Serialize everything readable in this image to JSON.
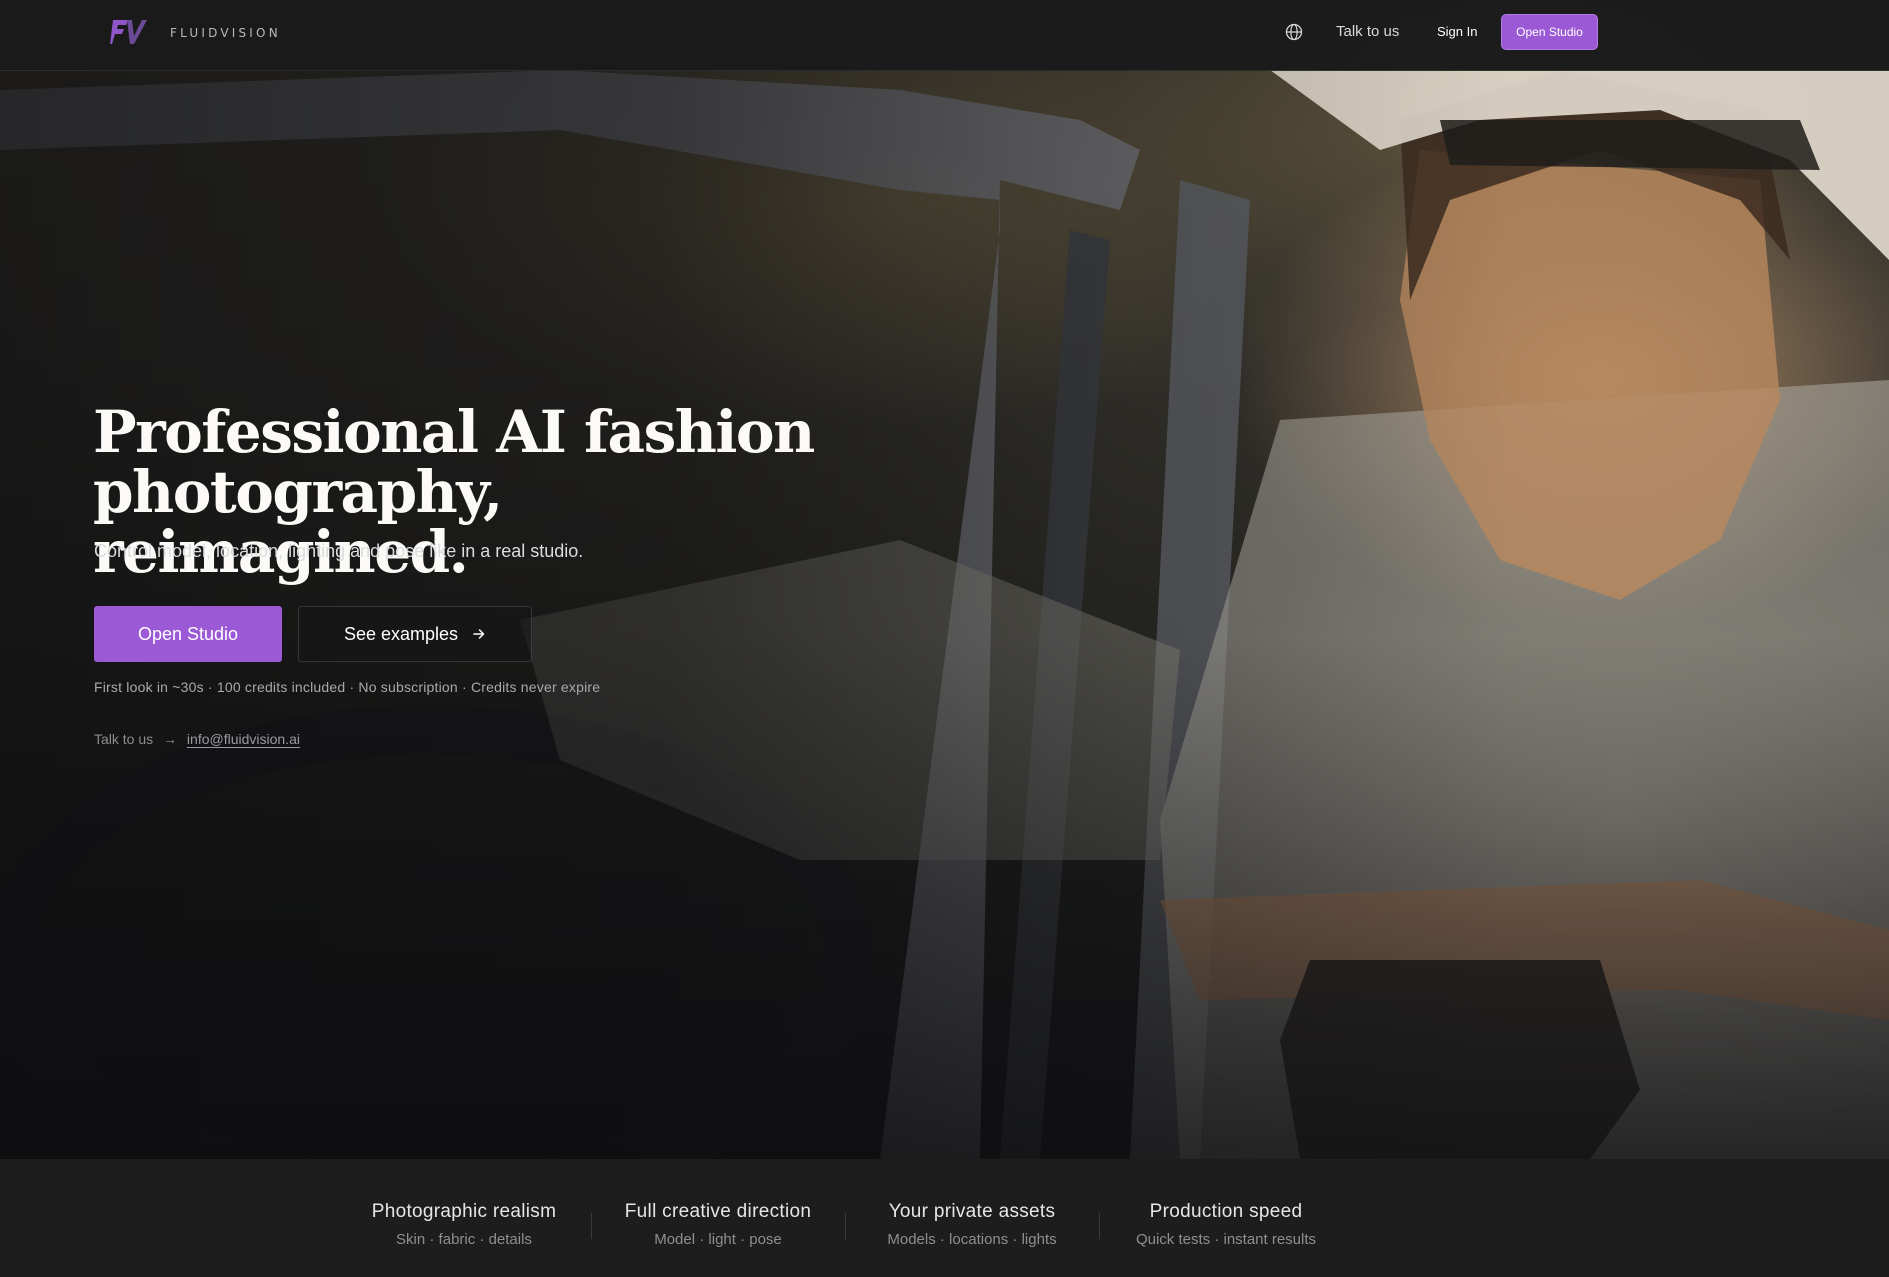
{
  "nav": {
    "brand": "FLUIDVISION",
    "logo_icon": "fv-logo",
    "globe_icon": "globe-icon",
    "talk_label": "Talk to us",
    "signin_label": "Sign In",
    "open_label": "Open Studio"
  },
  "hero": {
    "headline": "Professional AI fashion photography, reimagined.",
    "subhead": "Control model, location, lighting and pose like in a real studio.",
    "primary_cta": "Open Studio",
    "secondary_cta": "See examples",
    "secondary_icon": "arrow-right-icon",
    "fineprint": "First look in ~30s · 100 credits included · No subscription · Credits never expire",
    "contact_label": "Talk to us",
    "contact_arrow": "→",
    "contact_email": "info@fluidvision.ai"
  },
  "features": [
    {
      "title": "Photographic realism",
      "subtitle": "Skin · fabric · details"
    },
    {
      "title": "Full creative direction",
      "subtitle": "Model · light · pose"
    },
    {
      "title": "Your private assets",
      "subtitle": "Models · locations · lights"
    },
    {
      "title": "Production speed",
      "subtitle": "Quick tests · instant results"
    }
  ],
  "colors": {
    "accent": "#9b59d6",
    "nav_bg": "#1a1a1b",
    "features_bg": "#1d1d1e"
  }
}
